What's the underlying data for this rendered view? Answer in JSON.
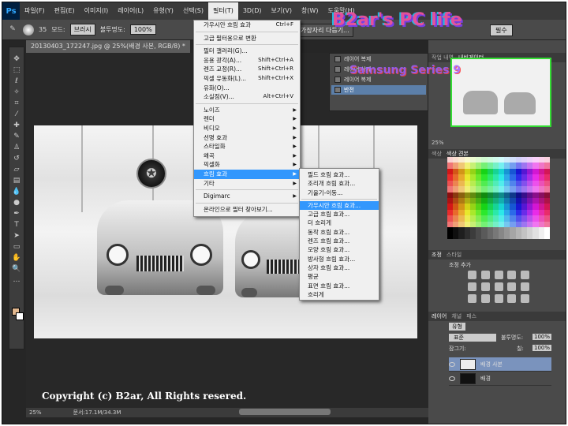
{
  "app": {
    "logo": "Ps"
  },
  "menubar": {
    "items": [
      "파일(F)",
      "편집(E)",
      "이미지(I)",
      "레이어(L)",
      "유형(Y)",
      "선택(S)",
      "필터(T)",
      "3D(D)",
      "보기(V)",
      "창(W)",
      "도움말(H)"
    ],
    "active_index": 6
  },
  "options": {
    "brush_size": "35",
    "mode_label": "모드:",
    "mode_value": "브러시",
    "opacity_label": "불투명도:",
    "opacity_value": "100%",
    "edge_button": "가장자리 다듬기...",
    "workspace": "필수"
  },
  "document": {
    "tab_title": "20130403_172247.jpg @ 25%(배경 사본, RGB/8) *",
    "watermark": "Copyright (c) B2ar, All Rights resered.",
    "zoom": "25%",
    "doc_info": "문서:17.1M/34.3M"
  },
  "filter_menu": {
    "items": [
      {
        "label": "가우시안 흐림 효과",
        "shortcut": "Ctrl+F"
      },
      {
        "sep": true
      },
      {
        "label": "고급 필터용으로 변환"
      },
      {
        "sep": true
      },
      {
        "label": "필터 갤러리(G)..."
      },
      {
        "label": "응용 광각(A)...",
        "shortcut": "Shift+Ctrl+A"
      },
      {
        "label": "렌즈 교정(R)...",
        "shortcut": "Shift+Ctrl+R"
      },
      {
        "label": "픽셀 유동화(L)...",
        "shortcut": "Shift+Ctrl+X"
      },
      {
        "label": "유화(O)..."
      },
      {
        "label": "소실점(V)...",
        "shortcut": "Alt+Ctrl+V"
      },
      {
        "sep": true
      },
      {
        "label": "노이즈",
        "submenu": true
      },
      {
        "label": "렌더",
        "submenu": true
      },
      {
        "label": "비디오",
        "submenu": true
      },
      {
        "label": "선명 효과",
        "submenu": true
      },
      {
        "label": "스타일화",
        "submenu": true
      },
      {
        "label": "왜곡",
        "submenu": true
      },
      {
        "label": "픽셀화",
        "submenu": true
      },
      {
        "label": "흐림 효과",
        "submenu": true,
        "highlight": true
      },
      {
        "label": "기타",
        "submenu": true
      },
      {
        "sep": true
      },
      {
        "label": "Digimarc",
        "submenu": true
      },
      {
        "sep": true
      },
      {
        "label": "온라인으로 필터 찾아보기..."
      }
    ]
  },
  "blur_menu": {
    "items": [
      {
        "label": "필드 흐림 효과..."
      },
      {
        "label": "조리개 흐림 효과..."
      },
      {
        "label": "기울기-이동..."
      },
      {
        "sep": true
      },
      {
        "label": "가우시안 흐림 효과...",
        "highlight": true
      },
      {
        "label": "고급 흐림 효과..."
      },
      {
        "label": "더 흐리게"
      },
      {
        "label": "동작 흐림 효과..."
      },
      {
        "label": "렌즈 흐림 효과..."
      },
      {
        "label": "모양 흐림 효과..."
      },
      {
        "label": "방사형 흐림 효과..."
      },
      {
        "label": "상자 흐림 효과..."
      },
      {
        "label": "평균"
      },
      {
        "label": "표면 흐림 효과..."
      },
      {
        "label": "흐리게"
      }
    ]
  },
  "history": {
    "tabs": [
      "작업 내역",
      "내비게이터"
    ],
    "rows": [
      {
        "label": "레이어 복제"
      },
      {
        "label": "레이어 삭제"
      },
      {
        "label": "레이어 복제"
      },
      {
        "label": "반전",
        "selected": true
      }
    ]
  },
  "panels": {
    "nav_zoom": "25%",
    "swatch_tabs": [
      "색상",
      "색상 견본"
    ],
    "adjust_tabs": [
      "조정",
      "스타일"
    ],
    "adjust_title": "조정 추가",
    "layer_tabs": [
      "레이어",
      "채널",
      "패스"
    ],
    "layer_filter": "유형",
    "blend_mode": "표준",
    "opacity_label": "불투명도:",
    "opacity_value": "100%",
    "lock_label": "잠그기:",
    "fill_label": "칠:",
    "fill_value": "100%",
    "layers": [
      {
        "name": "배경 사본",
        "selected": true
      },
      {
        "name": "배경",
        "selected": false
      }
    ]
  },
  "logo_overlay": {
    "line1": "B2ar's PC life",
    "line2": "Samsung Series 9"
  }
}
